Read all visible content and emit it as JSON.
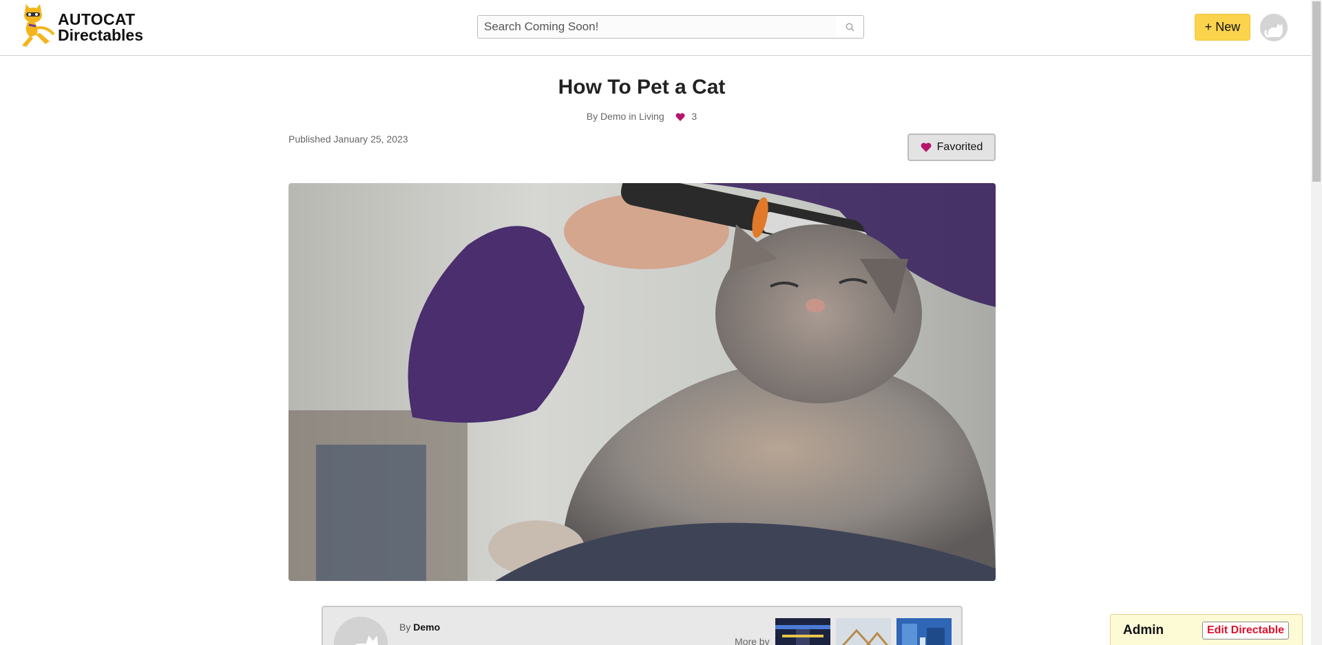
{
  "header": {
    "logo_line1": "AUTOCAT",
    "logo_line2": "Directables",
    "search_placeholder": "Search Coming Soon!",
    "new_button_label": "+ New"
  },
  "article": {
    "title": "How To Pet a Cat",
    "by_prefix": "By",
    "author": "Demo",
    "in_text": "in",
    "category": "Living",
    "favorite_count": "3",
    "published": "Published January 25, 2023",
    "favorite_button_label": "Favorited"
  },
  "author_card": {
    "by_prefix": "By",
    "author": "Demo",
    "more_by_label": "More by"
  },
  "admin": {
    "label": "Admin",
    "edit_button_label": "Edit Directable"
  },
  "colors": {
    "accent_yellow": "#fbd34d",
    "heart": "#b5166b",
    "edit_red": "#e0102a"
  },
  "icons": {
    "logo": "cat-logo-icon",
    "search": "search-icon",
    "user": "cat-avatar-icon",
    "favorite": "heart-icon"
  }
}
